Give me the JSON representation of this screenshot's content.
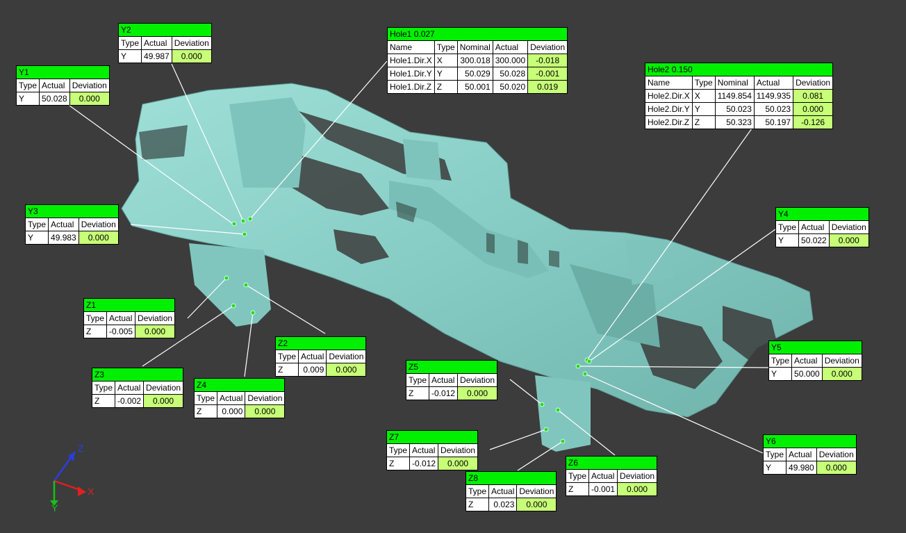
{
  "colors": {
    "background": "#3c3c3c",
    "part": "#8fd4cc",
    "header": "#00f000",
    "deviation_ok": "#c7ff78"
  },
  "axis_triad": {
    "x": "X",
    "y": "Y",
    "z": "Z"
  },
  "callouts": [
    {
      "id": "y2",
      "title": "Y2",
      "headers": [
        "Type",
        "Actual",
        "Deviation"
      ],
      "rows": [
        [
          "Y",
          "49.987",
          "0.000"
        ]
      ]
    },
    {
      "id": "y1",
      "title": "Y1",
      "headers": [
        "Type",
        "Actual",
        "Deviation"
      ],
      "rows": [
        [
          "Y",
          "50.028",
          "0.000"
        ]
      ]
    },
    {
      "id": "hole1",
      "title": "Hole1 0.027",
      "headers": [
        "Name",
        "Type",
        "Nominal",
        "Actual",
        "Deviation"
      ],
      "rows": [
        [
          "Hole1.Dir.X",
          "X",
          "300.018",
          "300.000",
          "-0.018"
        ],
        [
          "Hole1.Dir.Y",
          "Y",
          "50.029",
          "50.028",
          "-0.001"
        ],
        [
          "Hole1.Dir.Z",
          "Z",
          "50.001",
          "50.020",
          "0.019"
        ]
      ]
    },
    {
      "id": "hole2",
      "title": "Hole2 0.150",
      "headers": [
        "Name",
        "Type",
        "Nominal",
        "Actual",
        "Deviation"
      ],
      "rows": [
        [
          "Hole2.Dir.X",
          "X",
          "1149.854",
          "1149.935",
          "0.081"
        ],
        [
          "Hole2.Dir.Y",
          "Y",
          "50.023",
          "50.023",
          "0.000"
        ],
        [
          "Hole2.Dir.Z",
          "Z",
          "50.323",
          "50.197",
          "-0.126"
        ]
      ]
    },
    {
      "id": "y3",
      "title": "Y3",
      "headers": [
        "Type",
        "Actual",
        "Deviation"
      ],
      "rows": [
        [
          "Y",
          "49.983",
          "0.000"
        ]
      ]
    },
    {
      "id": "y4",
      "title": "Y4",
      "headers": [
        "Type",
        "Actual",
        "Deviation"
      ],
      "rows": [
        [
          "Y",
          "50.022",
          "0.000"
        ]
      ]
    },
    {
      "id": "z1",
      "title": "Z1",
      "headers": [
        "Type",
        "Actual",
        "Deviation"
      ],
      "rows": [
        [
          "Z",
          "-0.005",
          "0.000"
        ]
      ]
    },
    {
      "id": "z2",
      "title": "Z2",
      "headers": [
        "Type",
        "Actual",
        "Deviation"
      ],
      "rows": [
        [
          "Z",
          "0.009",
          "0.000"
        ]
      ]
    },
    {
      "id": "z3",
      "title": "Z3",
      "headers": [
        "Type",
        "Actual",
        "Deviation"
      ],
      "rows": [
        [
          "Z",
          "-0.002",
          "0.000"
        ]
      ]
    },
    {
      "id": "z4",
      "title": "Z4",
      "headers": [
        "Type",
        "Actual",
        "Deviation"
      ],
      "rows": [
        [
          "Z",
          "0.000",
          "0.000"
        ]
      ]
    },
    {
      "id": "z5",
      "title": "Z5",
      "headers": [
        "Type",
        "Actual",
        "Deviation"
      ],
      "rows": [
        [
          "Z",
          "-0.012",
          "0.000"
        ]
      ]
    },
    {
      "id": "y5",
      "title": "Y5",
      "headers": [
        "Type",
        "Actual",
        "Deviation"
      ],
      "rows": [
        [
          "Y",
          "50.000",
          "0.000"
        ]
      ]
    },
    {
      "id": "z7",
      "title": "Z7",
      "headers": [
        "Type",
        "Actual",
        "Deviation"
      ],
      "rows": [
        [
          "Z",
          "-0.012",
          "0.000"
        ]
      ]
    },
    {
      "id": "y6",
      "title": "Y6",
      "headers": [
        "Type",
        "Actual",
        "Deviation"
      ],
      "rows": [
        [
          "Y",
          "49.980",
          "0.000"
        ]
      ]
    },
    {
      "id": "z6",
      "title": "Z6",
      "headers": [
        "Type",
        "Actual",
        "Deviation"
      ],
      "rows": [
        [
          "Z",
          "-0.001",
          "0.000"
        ]
      ]
    },
    {
      "id": "z8",
      "title": "Z8",
      "headers": [
        "Type",
        "Actual",
        "Deviation"
      ],
      "rows": [
        [
          "Z",
          "0.023",
          "0.000"
        ]
      ]
    }
  ]
}
